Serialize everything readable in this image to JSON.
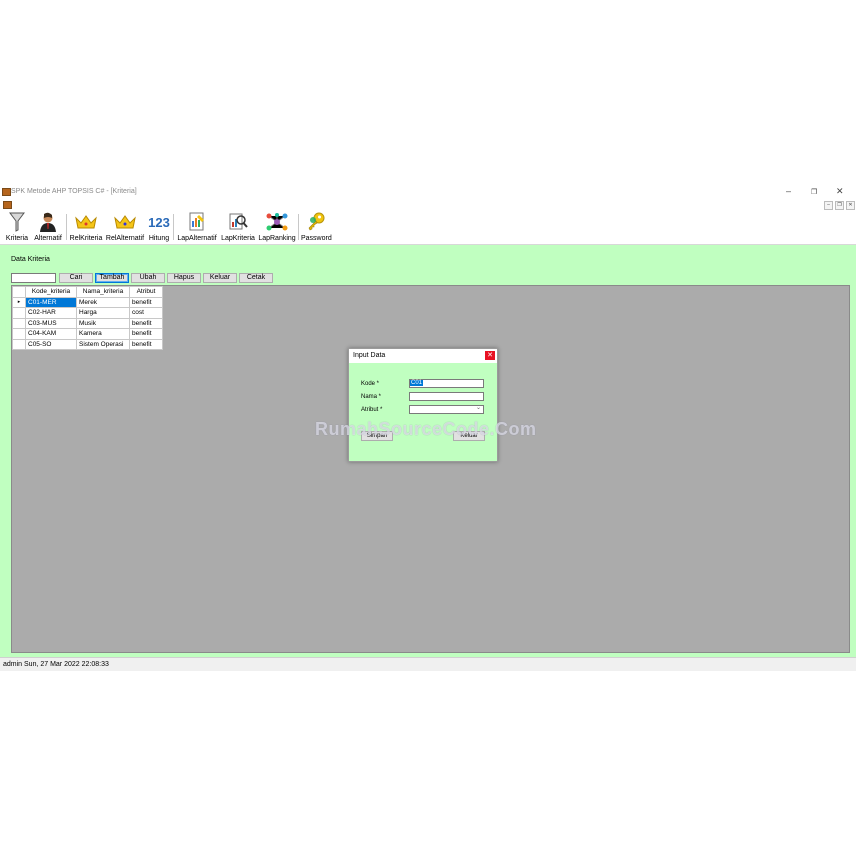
{
  "window": {
    "title": "SPK Metode AHP TOPSIS C# - [Kriteria]",
    "controls": {
      "minimize": "–",
      "maximize": "❐",
      "close": "✕"
    }
  },
  "mdi_controls": {
    "minimize": "–",
    "restore": "❐",
    "close": "✕"
  },
  "toolbar": {
    "items": [
      {
        "label": "Kriteria",
        "icon": "funnel-icon"
      },
      {
        "label": "Alternatif",
        "icon": "person-icon"
      },
      {
        "label": "RelKriteria",
        "icon": "crown-icon"
      },
      {
        "label": "RelAlternatif",
        "icon": "crown-icon"
      },
      {
        "label": "Hitung",
        "icon": "numbers-icon"
      },
      {
        "label": "LapAlternatif",
        "icon": "report-icon"
      },
      {
        "label": "LapKriteria",
        "icon": "search-report-icon"
      },
      {
        "label": "LapRanking",
        "icon": "network-icon"
      },
      {
        "label": "Password",
        "icon": "keys-icon"
      }
    ],
    "icon_text": {
      "hitung": "123"
    }
  },
  "form": {
    "section_title": "Data Kriteria",
    "search_value": "",
    "buttons": {
      "cari": "Cari",
      "tambah": "Tambah",
      "ubah": "Ubah",
      "hapus": "Hapus",
      "keluar": "Keluar",
      "cetak": "Cetak"
    }
  },
  "grid": {
    "columns": [
      "Kode_kriteria",
      "Nama_kriteria",
      "Atribut"
    ],
    "rows": [
      [
        "C01-MER",
        "Merek",
        "benefit"
      ],
      [
        "C02-HAR",
        "Harga",
        "cost"
      ],
      [
        "C03-MUS",
        "Musik",
        "benefit"
      ],
      [
        "C04-KAM",
        "Kamera",
        "benefit"
      ],
      [
        "C05-SO",
        "Sistem Operasi",
        "benefit"
      ]
    ],
    "row_indicator": "▸"
  },
  "status": {
    "text": "admin Sun, 27 Mar 2022 22:08:33"
  },
  "dialog": {
    "title": "Input Data",
    "close": "✕",
    "kode_label": "Kode *",
    "kode_value": "C01",
    "nama_label": "Nama *",
    "nama_value": "",
    "atribut_label": "Atribut *",
    "atribut_value": "",
    "simpan_label": "Simpan",
    "keluar_label": "Keluar"
  },
  "watermark": "RumahSourceCode.Com",
  "colors": {
    "client_bg": "#c0ffc0",
    "grid_panel_bg": "#ababab",
    "selection": "#0078d7",
    "close_red": "#e81123"
  }
}
